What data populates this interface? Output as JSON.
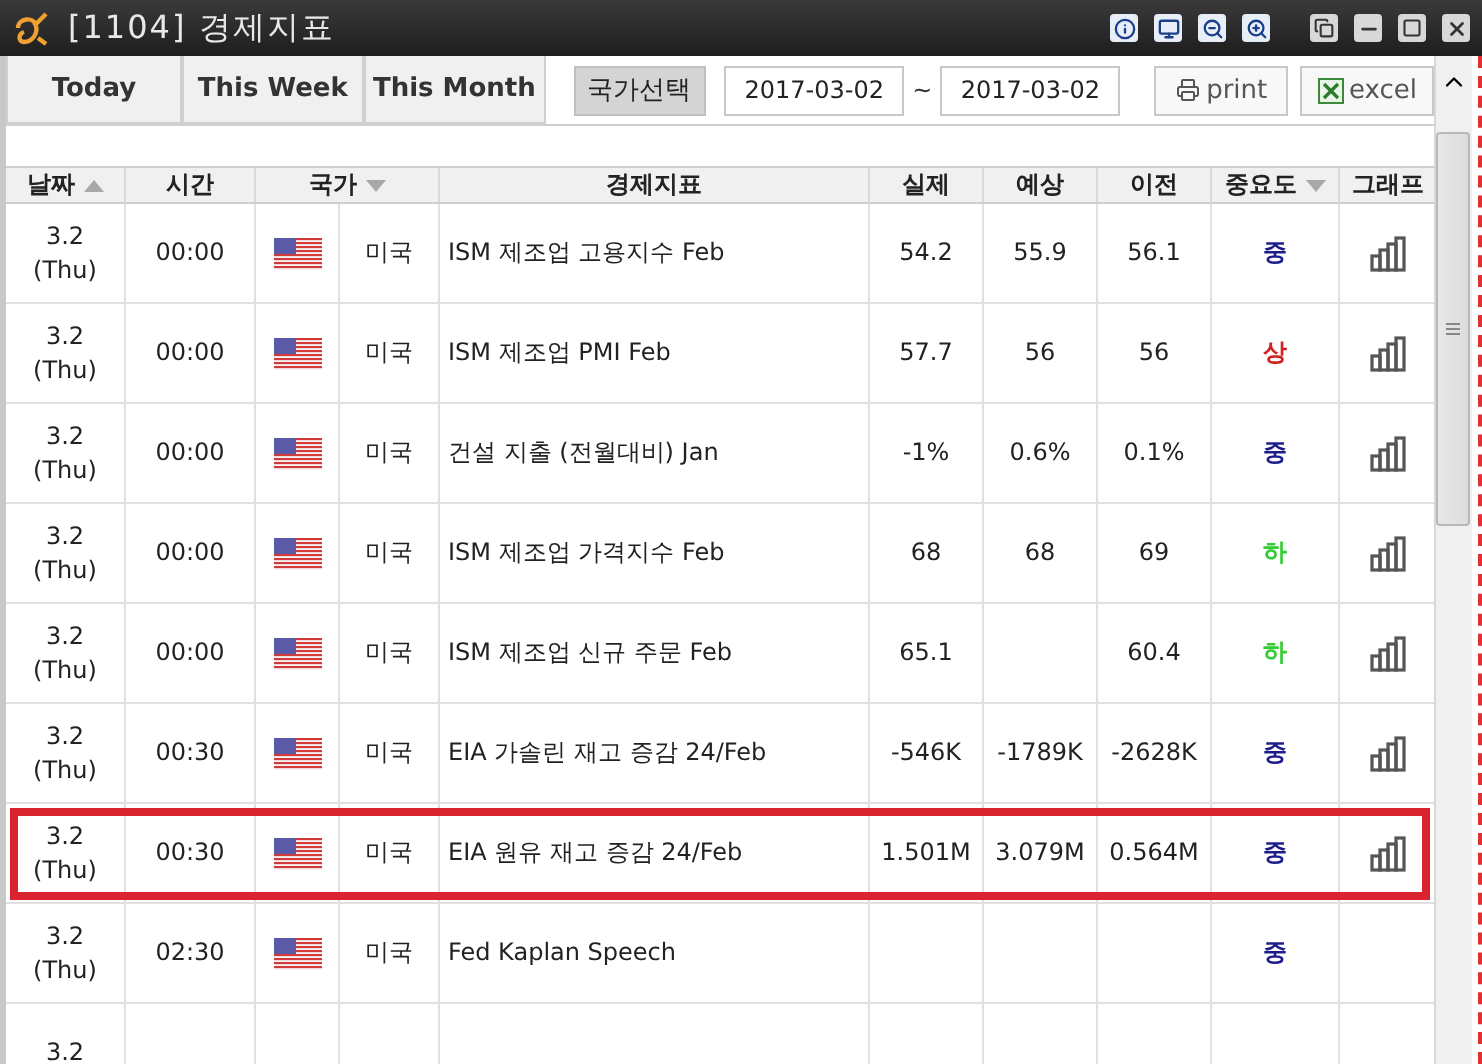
{
  "window": {
    "title": "[1104] 경제지표"
  },
  "toolbar": {
    "tabs": [
      "Today",
      "This Week",
      "This Month"
    ],
    "country_button": "국가선택",
    "date_from": "2017-03-02",
    "separator": "~",
    "date_to": "2017-03-02",
    "print": "print",
    "excel": "excel"
  },
  "table": {
    "columns": [
      {
        "label": "날짜",
        "sort_up": true
      },
      {
        "label": "시간"
      },
      {
        "label": "국가",
        "sort_down": true
      },
      {
        "label": "경제지표"
      },
      {
        "label": "실제"
      },
      {
        "label": "예상"
      },
      {
        "label": "이전"
      },
      {
        "label": "중요도",
        "sort_down": true
      },
      {
        "label": "그래프"
      }
    ],
    "rows": [
      {
        "date": "3.2",
        "day": "(Thu)",
        "time": "00:00",
        "country": "미국",
        "indicator": "ISM 제조업 고용지수 Feb",
        "actual": "54.2",
        "forecast": "55.9",
        "previous": "56.1",
        "importance": {
          "label": "중",
          "color": "#1c1c8c"
        },
        "graph": true,
        "highlighted": false
      },
      {
        "date": "3.2",
        "day": "(Thu)",
        "time": "00:00",
        "country": "미국",
        "indicator": "ISM 제조업 PMI Feb",
        "actual": "57.7",
        "forecast": "56",
        "previous": "56",
        "importance": {
          "label": "상",
          "color": "#d02020"
        },
        "graph": true,
        "highlighted": false
      },
      {
        "date": "3.2",
        "day": "(Thu)",
        "time": "00:00",
        "country": "미국",
        "indicator": "건설 지출 (전월대비) Jan",
        "actual": "-1%",
        "forecast": "0.6%",
        "previous": "0.1%",
        "importance": {
          "label": "중",
          "color": "#1c1c8c"
        },
        "graph": true,
        "highlighted": false
      },
      {
        "date": "3.2",
        "day": "(Thu)",
        "time": "00:00",
        "country": "미국",
        "indicator": "ISM 제조업 가격지수 Feb",
        "actual": "68",
        "forecast": "68",
        "previous": "69",
        "importance": {
          "label": "하",
          "color": "#33cc33"
        },
        "graph": true,
        "highlighted": false
      },
      {
        "date": "3.2",
        "day": "(Thu)",
        "time": "00:00",
        "country": "미국",
        "indicator": "ISM 제조업 신규 주문 Feb",
        "actual": "65.1",
        "previous": "60.4",
        "importance": {
          "label": "하",
          "color": "#33cc33"
        },
        "graph": true,
        "highlighted": false
      },
      {
        "date": "3.2",
        "day": "(Thu)",
        "time": "00:30",
        "country": "미국",
        "indicator": "EIA 가솔린 재고 증감 24/Feb",
        "actual": "-546K",
        "forecast": "-1789K",
        "previous": "-2628K",
        "importance": {
          "label": "중",
          "color": "#1c1c8c"
        },
        "graph": true,
        "highlighted": false
      },
      {
        "date": "3.2",
        "day": "(Thu)",
        "time": "00:30",
        "country": "미국",
        "indicator": "EIA 원유 재고 증감 24/Feb",
        "actual": "1.501M",
        "forecast": "3.079M",
        "previous": "0.564M",
        "importance": {
          "label": "중",
          "color": "#1c1c8c"
        },
        "graph": true,
        "highlighted": true
      },
      {
        "date": "3.2",
        "day": "(Thu)",
        "time": "02:30",
        "country": "미국",
        "indicator": "Fed Kaplan Speech",
        "importance": {
          "label": "중",
          "color": "#1c1c8c"
        },
        "graph": false,
        "highlighted": false
      },
      {
        "date": "3.2",
        "graph": false,
        "highlighted": false
      }
    ]
  }
}
